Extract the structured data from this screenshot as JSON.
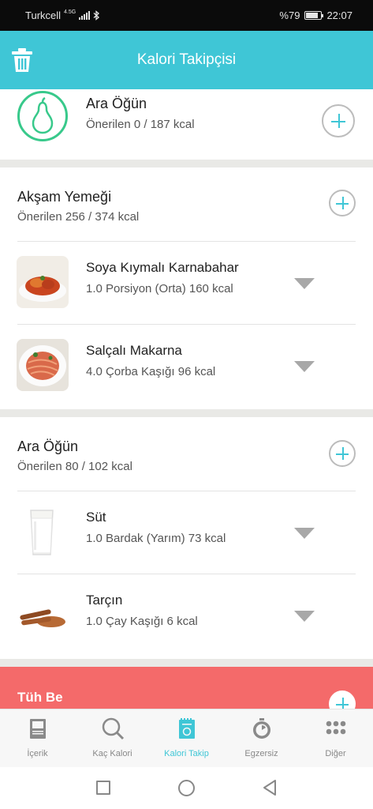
{
  "status_bar": {
    "carrier": "Turkcell",
    "network": "4.5G",
    "battery_text": "%79",
    "battery_level": 0.79,
    "time": "22:07"
  },
  "app_bar": {
    "title": "Kalori Takipçisi",
    "trash_icon": "trash-icon"
  },
  "snack_top": {
    "title": "Ara Öğün",
    "recommended": "Önerilen 0 / 187 kcal",
    "icon": "pear-icon"
  },
  "dinner": {
    "title": "Akşam Yemeği",
    "recommended": "Önerilen 256 / 374 kcal",
    "items": [
      {
        "name": "Soya Kıymalı Karnabahar",
        "detail": "1.0 Porsiyon (Orta) 160 kcal"
      },
      {
        "name": "Salçalı Makarna",
        "detail": "4.0 Çorba Kaşığı 96 kcal"
      }
    ]
  },
  "snack_2": {
    "title": "Ara Öğün",
    "recommended": "Önerilen 80 / 102 kcal",
    "items": [
      {
        "name": "Süt",
        "detail": "1.0 Bardak (Yarım) 73 kcal"
      },
      {
        "name": "Tarçın",
        "detail": "1.0 Çay Kaşığı 6 kcal"
      }
    ]
  },
  "cheat": {
    "title": "Tüh Be"
  },
  "bottom_nav": {
    "items": [
      {
        "label": "İçerik",
        "icon": "book-icon"
      },
      {
        "label": "Kaç Kalori",
        "icon": "search-icon"
      },
      {
        "label": "Kalori Takip",
        "icon": "notepad-icon",
        "active": true
      },
      {
        "label": "Egzersiz",
        "icon": "stopwatch-icon"
      },
      {
        "label": "Diğer",
        "icon": "grid-dots-icon"
      }
    ]
  },
  "colors": {
    "primary": "#3fc6d6",
    "green": "#38c98b",
    "red": "#f46a6a"
  }
}
